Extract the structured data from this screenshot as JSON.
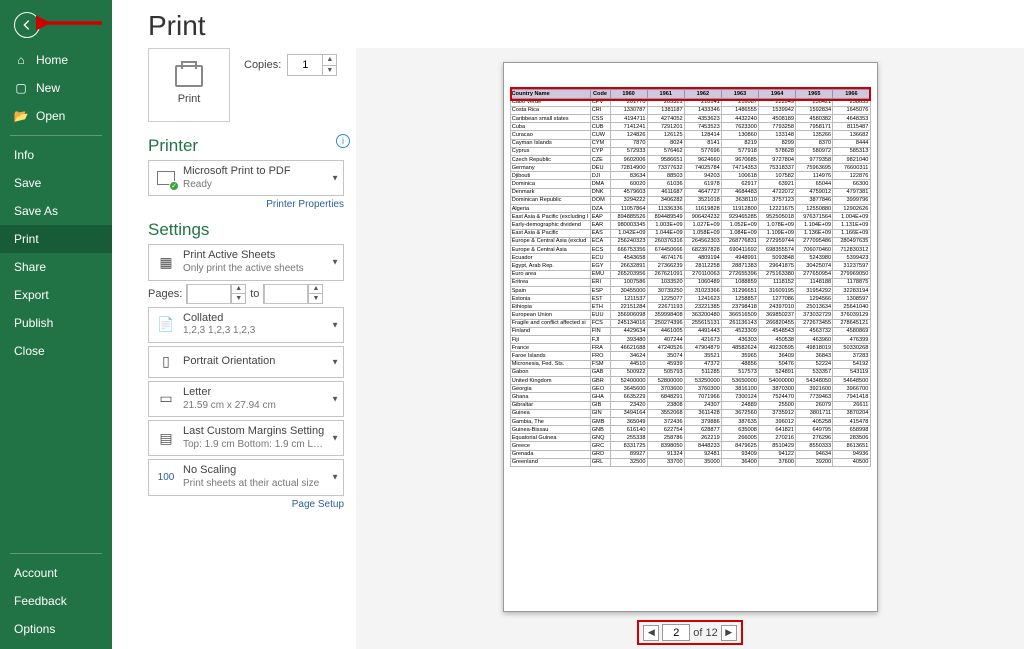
{
  "sidebar": {
    "items": [
      {
        "label": "Home",
        "icon": "⌂"
      },
      {
        "label": "New",
        "icon": "▢"
      },
      {
        "label": "Open",
        "icon": "📂"
      }
    ],
    "file_items": [
      "Info",
      "Save",
      "Save As",
      "Print",
      "Share",
      "Export",
      "Publish",
      "Close"
    ],
    "selected": "Print",
    "bottom": [
      "Account",
      "Feedback",
      "Options"
    ]
  },
  "heading": "Print",
  "print_button_label": "Print",
  "copies_label": "Copies:",
  "copies_value": "1",
  "printer": {
    "section": "Printer",
    "name": "Microsoft Print to PDF",
    "status": "Ready",
    "properties_link": "Printer Properties"
  },
  "settings": {
    "section": "Settings",
    "sheets": {
      "main": "Print Active Sheets",
      "sub": "Only print the active sheets"
    },
    "pages_label": "Pages:",
    "pages_to": "to",
    "collated": {
      "main": "Collated",
      "sub": "1,2,3   1,2,3   1,2,3"
    },
    "orientation": {
      "main": "Portrait Orientation"
    },
    "paper": {
      "main": "Letter",
      "sub": "21.59 cm x 27.94 cm"
    },
    "margins": {
      "main": "Last Custom Margins Setting",
      "sub": "Top: 1.9 cm Bottom: 1.9 cm L…"
    },
    "scaling": {
      "main": "No Scaling",
      "sub": "Print sheets at their actual size"
    },
    "page_setup_link": "Page Setup"
  },
  "pager": {
    "current": "2",
    "of_label": "of",
    "total": "12"
  },
  "chart_data": {
    "type": "table",
    "headers": [
      "Country Name",
      "Code",
      "1960",
      "1961",
      "1962",
      "1963",
      "1964",
      "1965",
      "1966"
    ],
    "rows": [
      [
        "Cabo Verde",
        "CPV",
        "201770",
        "205321",
        "210141",
        "216087",
        "222949",
        "230421",
        "238655"
      ],
      [
        "Costa Rica",
        "CRI",
        "1330787",
        "1381187",
        "1433346",
        "1486555",
        "1539942",
        "1592834",
        "1645076"
      ],
      [
        "Caribbean small states",
        "CSS",
        "4194711",
        "4274052",
        "4353623",
        "4432240",
        "4508189",
        "4580382",
        "4648353"
      ],
      [
        "Cuba",
        "CUB",
        "7141241",
        "7291201",
        "7453523",
        "7623300",
        "7793258",
        "7958171",
        "8115487"
      ],
      [
        "Curacao",
        "CUW",
        "124826",
        "126125",
        "128414",
        "130860",
        "133148",
        "135266",
        "136682"
      ],
      [
        "Cayman Islands",
        "CYM",
        "7870",
        "8024",
        "8141",
        "8219",
        "8299",
        "8370",
        "8444"
      ],
      [
        "Cyprus",
        "CYP",
        "572933",
        "576462",
        "577696",
        "577918",
        "578628",
        "580972",
        "585313"
      ],
      [
        "Czech Republic",
        "CZE",
        "9602006",
        "9586651",
        "9624660",
        "9670685",
        "9727804",
        "9779358",
        "9821040"
      ],
      [
        "Germany",
        "DEU",
        "72814900",
        "73377632",
        "74025784",
        "74714353",
        "75318337",
        "75963695",
        "76600311"
      ],
      [
        "Djibouti",
        "DJI",
        "83634",
        "88503",
        "94203",
        "100618",
        "107582",
        "114976",
        "122876"
      ],
      [
        "Dominica",
        "DMA",
        "60020",
        "61036",
        "61978",
        "62917",
        "63921",
        "65044",
        "66300"
      ],
      [
        "Denmark",
        "DNK",
        "4579603",
        "4611687",
        "4647727",
        "4684483",
        "4722072",
        "4759012",
        "4797381"
      ],
      [
        "Dominican Republic",
        "DOM",
        "3294222",
        "3406282",
        "3521018",
        "3638110",
        "3757123",
        "3877846",
        "3999796"
      ],
      [
        "Algeria",
        "DZA",
        "11057864",
        "11336336",
        "11619828",
        "11912800",
        "12221675",
        "12550880",
        "12902626"
      ],
      [
        "East Asia & Pacific (excluding I",
        "EAP",
        "894885526",
        "894489549",
        "906424232",
        "929465285",
        "952505018",
        "976371564",
        "1.004E+09"
      ],
      [
        "Early-demographic dividend",
        "EAR",
        "980003345",
        "1.003E+09",
        "1.027E+09",
        "1.052E+09",
        "1.078E+09",
        "1.104E+09",
        "1.131E+09"
      ],
      [
        "East Asia & Pacific",
        "EAS",
        "1.042E+09",
        "1.044E+09",
        "1.058E+09",
        "1.084E+09",
        "1.109E+09",
        "1.136E+09",
        "1.166E+09"
      ],
      [
        "Europe & Central Asia (exclud",
        "ECA",
        "256240323",
        "260376316",
        "264562303",
        "268776831",
        "272959744",
        "277095486",
        "280497635"
      ],
      [
        "Europe & Central Asia",
        "ECS",
        "666753356",
        "674450666",
        "682397828",
        "690411692",
        "698355574",
        "706070460",
        "712830312"
      ],
      [
        "Ecuador",
        "ECU",
        "4543658",
        "4674176",
        "4809194",
        "4948991",
        "5093848",
        "5243980",
        "5399423"
      ],
      [
        "Egypt, Arab Rep.",
        "EGY",
        "26632891",
        "27366239",
        "28112258",
        "28871383",
        "29641875",
        "30425074",
        "31237597"
      ],
      [
        "Euro area",
        "EMU",
        "265203956",
        "267621091",
        "270110063",
        "272655396",
        "275163380",
        "277650954",
        "279969050"
      ],
      [
        "Eritrea",
        "ERI",
        "1007586",
        "1033520",
        "1060489",
        "1088859",
        "1118152",
        "1148188",
        "1178875"
      ],
      [
        "Spain",
        "ESP",
        "30455000",
        "30739250",
        "31023366",
        "31296651",
        "31609195",
        "31954292",
        "32283194"
      ],
      [
        "Estonia",
        "EST",
        "1211537",
        "1225077",
        "1241623",
        "1258857",
        "1277086",
        "1294566",
        "1308597"
      ],
      [
        "Ethiopia",
        "ETH",
        "22151284",
        "22671193",
        "23221385",
        "23798418",
        "24397010",
        "25013634",
        "25641040"
      ],
      [
        "European Union",
        "EUU",
        "356906098",
        "359998408",
        "363200480",
        "366516509",
        "369850237",
        "373032729",
        "376039129"
      ],
      [
        "Fragile and conflict affected si",
        "FCS",
        "245134016",
        "250274396",
        "255615131",
        "261136143",
        "266820455",
        "272673455",
        "278645121"
      ],
      [
        "Finland",
        "FIN",
        "4429634",
        "4461005",
        "4491443",
        "4523309",
        "4548543",
        "4563732",
        "4580869"
      ],
      [
        "Fiji",
        "FJI",
        "393480",
        "407244",
        "421673",
        "436303",
        "450538",
        "463960",
        "476399"
      ],
      [
        "France",
        "FRA",
        "46621688",
        "47240526",
        "47904879",
        "48582624",
        "49230595",
        "49818019",
        "50330268"
      ],
      [
        "Faroe Islands",
        "FRO",
        "34624",
        "35074",
        "35521",
        "35965",
        "36409",
        "36843",
        "37283"
      ],
      [
        "Micronesia, Fed. Sts.",
        "FSM",
        "44510",
        "45939",
        "47372",
        "48856",
        "50476",
        "52224",
        "54192"
      ],
      [
        "Gabon",
        "GAB",
        "500922",
        "505793",
        "511285",
        "517573",
        "524891",
        "533357",
        "543119"
      ],
      [
        "United Kingdom",
        "GBR",
        "52400000",
        "52800000",
        "53250000",
        "53650000",
        "54000000",
        "54348050",
        "54648500"
      ],
      [
        "Georgia",
        "GEO",
        "3645600",
        "3703600",
        "3760300",
        "3816100",
        "3870300",
        "3921600",
        "3966700"
      ],
      [
        "Ghana",
        "GHA",
        "6635229",
        "6848291",
        "7071966",
        "7300124",
        "7524470",
        "7739463",
        "7941418"
      ],
      [
        "Gibraltar",
        "GIB",
        "23420",
        "23808",
        "24307",
        "24889",
        "25500",
        "26079",
        "26611"
      ],
      [
        "Guinea",
        "GIN",
        "3494164",
        "3552068",
        "3611428",
        "3672560",
        "3735912",
        "3801711",
        "3870204"
      ],
      [
        "Gambia, The",
        "GMB",
        "365049",
        "372436",
        "379886",
        "387635",
        "396012",
        "405258",
        "415478"
      ],
      [
        "Guinea-Bissau",
        "GNB",
        "616140",
        "622754",
        "628877",
        "635008",
        "641821",
        "649795",
        "658998"
      ],
      [
        "Equatorial Guinea",
        "GNQ",
        "255338",
        "258786",
        "262219",
        "266005",
        "270216",
        "276296",
        "283506"
      ],
      [
        "Greece",
        "GRC",
        "8331725",
        "8398050",
        "8448233",
        "8479625",
        "8510429",
        "8550333",
        "8613651"
      ],
      [
        "Grenada",
        "GRD",
        "89927",
        "91324",
        "92481",
        "93409",
        "94122",
        "94634",
        "94936"
      ],
      [
        "Greenland",
        "GRL",
        "32500",
        "33700",
        "35000",
        "36400",
        "37600",
        "39200",
        "40500"
      ]
    ]
  }
}
